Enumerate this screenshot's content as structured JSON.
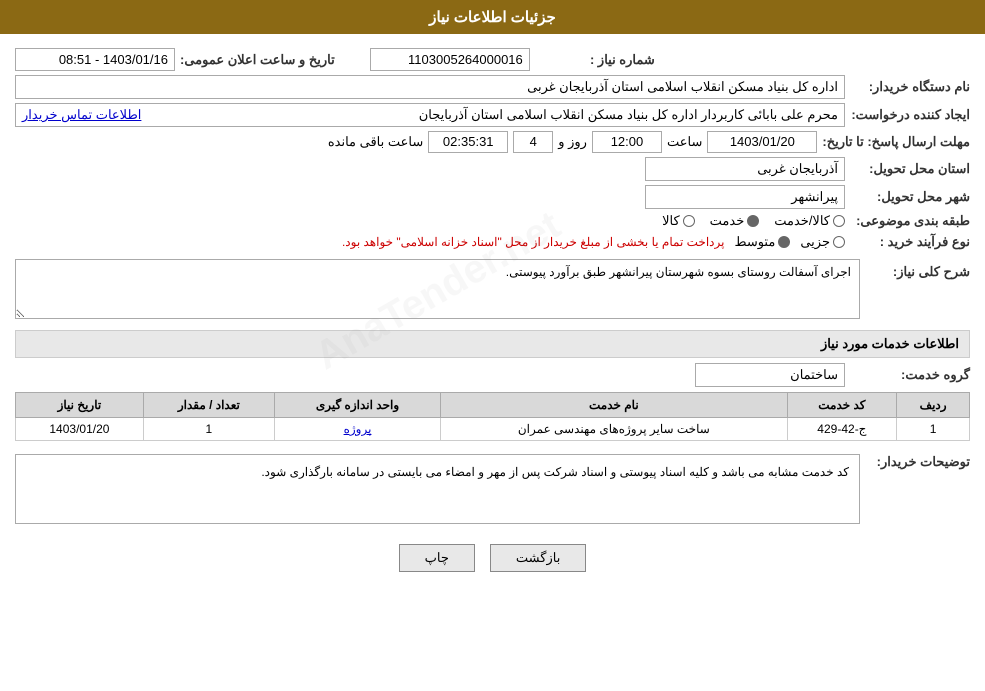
{
  "header": {
    "title": "جزئیات اطلاعات نیاز"
  },
  "main": {
    "need_number_label": "شماره نیاز :",
    "need_number_value": "1103005264000016",
    "announce_date_label": "تاریخ و ساعت اعلان عمومی:",
    "announce_date_value": "1403/01/16 - 08:51",
    "buyer_org_label": "نام دستگاه خریدار:",
    "buyer_org_value": "اداره کل بنیاد مسکن انقلاب اسلامی استان آذربایجان غربی",
    "creator_label": "ایجاد کننده درخواست:",
    "creator_value": "محرم علی بابائی کاربردار اداره کل بنیاد مسکن انقلاب اسلامی استان آذربایجان",
    "contact_link": "اطلاعات تماس خریدار",
    "deadline_label": "مهلت ارسال پاسخ: تا تاریخ:",
    "deadline_date": "1403/01/20",
    "deadline_time_label": "ساعت",
    "deadline_time_value": "12:00",
    "deadline_days_label": "روز و",
    "deadline_days_value": "4",
    "deadline_remaining_label": "ساعت باقی مانده",
    "deadline_remaining_value": "02:35:31",
    "province_label": "استان محل تحویل:",
    "province_value": "آذربایجان غربی",
    "city_label": "شهر محل تحویل:",
    "city_value": "پیرانشهر",
    "category_label": "طبقه بندی موضوعی:",
    "category_kala": "کالا",
    "category_khadamat": "خدمت",
    "category_kala_khadamat": "کالا/خدمت",
    "category_selected": "khadamat",
    "purchase_type_label": "نوع فرآیند خرید :",
    "purchase_type_jozee": "جزیی",
    "purchase_type_motosat": "متوسط",
    "purchase_type_desc": "پرداخت تمام یا بخشی از مبلغ خریدار از محل \"اسناد خزانه اسلامی\" خواهد بود.",
    "purchase_type_selected": "motosat",
    "general_desc_label": "شرح کلی نیاز:",
    "general_desc_value": "اجرای آسفالت روستای بسوه شهرستان پیرانشهر طبق برآورد پیوستی.",
    "services_section_title": "اطلاعات خدمات مورد نیاز",
    "service_group_label": "گروه خدمت:",
    "service_group_value": "ساختمان",
    "table": {
      "columns": [
        "ردیف",
        "کد خدمت",
        "نام خدمت",
        "واحد اندازه گیری",
        "تعداد / مقدار",
        "تاریخ نیاز"
      ],
      "rows": [
        {
          "row_num": "1",
          "service_code": "ج-42-429",
          "service_name": "ساخت سایر پروژه‌های مهندسی عمران",
          "unit": "پروژه",
          "quantity": "1",
          "date": "1403/01/20"
        }
      ]
    },
    "buyer_notes_label": "توضیحات خریدار:",
    "buyer_notes_value": "کد خدمت مشابه می باشد و کلیه اسناد پیوستی و اسناد شرکت پس از مهر و امضاء می بایستی در سامانه بارگذاری شود.",
    "btn_print": "چاپ",
    "btn_back": "بازگشت"
  }
}
